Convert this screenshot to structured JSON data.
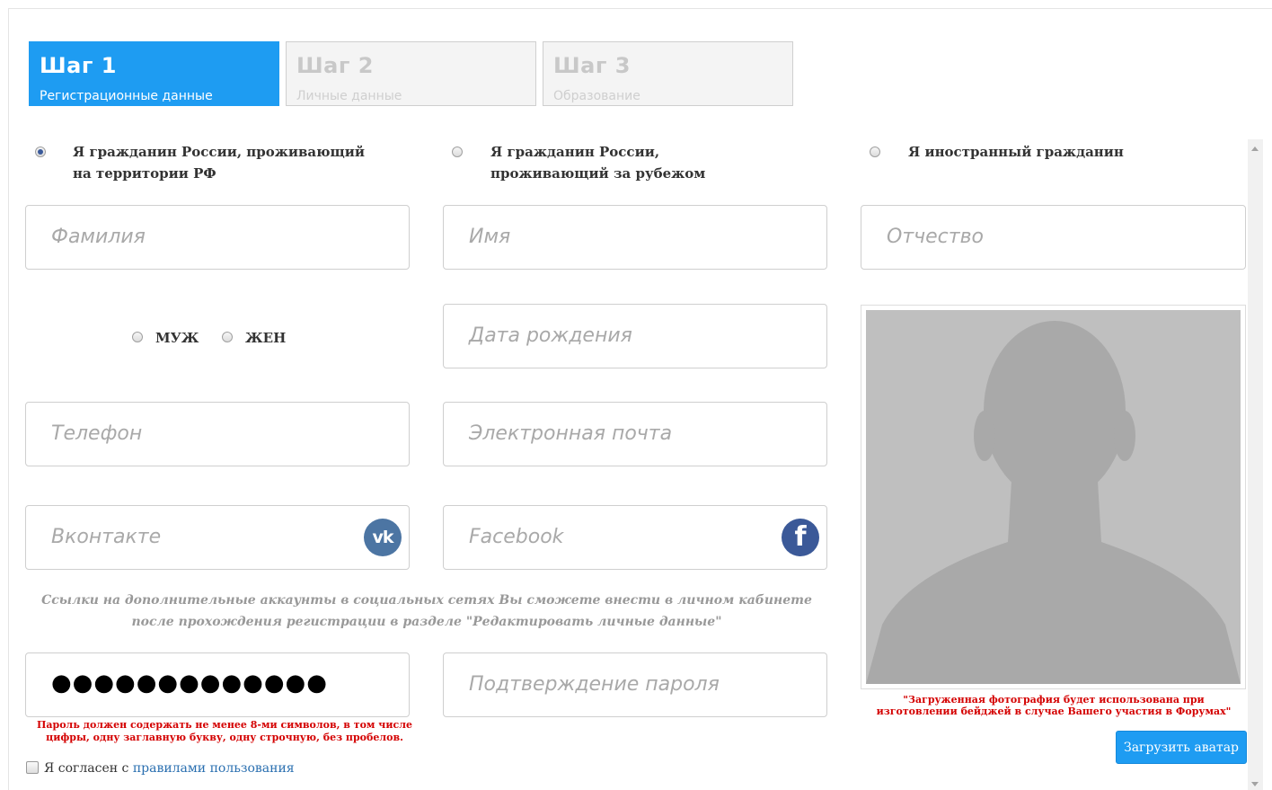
{
  "steps": [
    {
      "title": "Шаг 1",
      "subtitle": "Регистрационные данные"
    },
    {
      "title": "Шаг 2",
      "subtitle": "Личные данные"
    },
    {
      "title": "Шаг 3",
      "subtitle": "Образование"
    }
  ],
  "citizenship": {
    "option1": "Я гражданин России, проживающий на территории РФ",
    "option2": "Я гражданин России, проживающий за рубежом",
    "option3": "Я иностранный гражданин",
    "selected": "option1"
  },
  "gender": {
    "male": "МУЖ",
    "female": "ЖЕН"
  },
  "fields": {
    "surname": "Фамилия",
    "name": "Имя",
    "patronymic": "Отчество",
    "birthdate": "Дата рождения",
    "phone": "Телефон",
    "email": "Электронная почта",
    "vk": "Вконтакте",
    "facebook": "Facebook",
    "password_value": "●●●●●●●●●●●●●",
    "password_confirm": "Подтверждение пароля"
  },
  "social_note": "Ссылки на дополнительные аккаунты в социальных сетях Вы сможете внести в личном кабинете после прохождения регистрации в разделе \"Редактировать личные данные\"",
  "password_note": "Пароль должен содержать не менее 8-ми символов, в том числе цифры, одну заглавную букву, одну строчную, без пробелов.",
  "avatar_note": "\"Загруженная фотография будет использована при изготовлении бейджей в случае Вашего участия в Форумах\"",
  "upload_button": "Загрузить аватар",
  "agree": {
    "prefix": "Я согласен с ",
    "link": "правилами пользования"
  },
  "icons": {
    "vk": "vk-icon",
    "facebook": "facebook-icon",
    "avatar": "person-silhouette-icon"
  },
  "colors": {
    "accent": "#1e9cf2",
    "error": "#d40000",
    "vk": "#4c75a3",
    "facebook": "#3b5998"
  }
}
